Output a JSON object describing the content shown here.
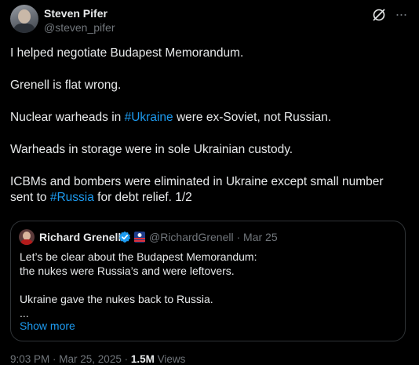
{
  "author": {
    "name": "Steven Pifer",
    "handle": "@steven_pifer"
  },
  "icons": {
    "grok": "grok-icon",
    "more": "more-icon",
    "verified": "verified-icon",
    "flag": "flag-icon"
  },
  "tweet": {
    "p1": "I helped negotiate Budapest Memorandum.",
    "p2": "Grenell is flat wrong.",
    "p3_pre": "Nuclear warheads in ",
    "p3_tag": "#Ukraine",
    "p3_post": " were ex-Soviet, not Russian.",
    "p4": "Warheads in storage were in sole Ukrainian custody.",
    "p5_pre": "ICBMs and bombers were eliminated in Ukraine except small number sent to ",
    "p5_tag": "#Russia",
    "p5_post": " for debt relief. 1/2"
  },
  "quote": {
    "name": "Richard Grenell",
    "handle": "@RichardGrenell",
    "sep": " · ",
    "date": "Mar 25",
    "line1": "Let’s be clear about the Budapest Memorandum:",
    "line2": "the nukes were Russia’s and were leftovers.",
    "line3": "Ukraine gave the nukes back to Russia.",
    "line4": "...",
    "show_more": "Show more"
  },
  "footer": {
    "time": "9:03 PM",
    "sep1": " · ",
    "date": "Mar 25, 2025",
    "sep2": " · ",
    "views": "1.5M",
    "views_label": " Views"
  },
  "colors": {
    "background": "#000000",
    "text": "#e7e9ea",
    "muted": "#71767b",
    "link": "#1d9bf0",
    "border": "#2f3336"
  }
}
